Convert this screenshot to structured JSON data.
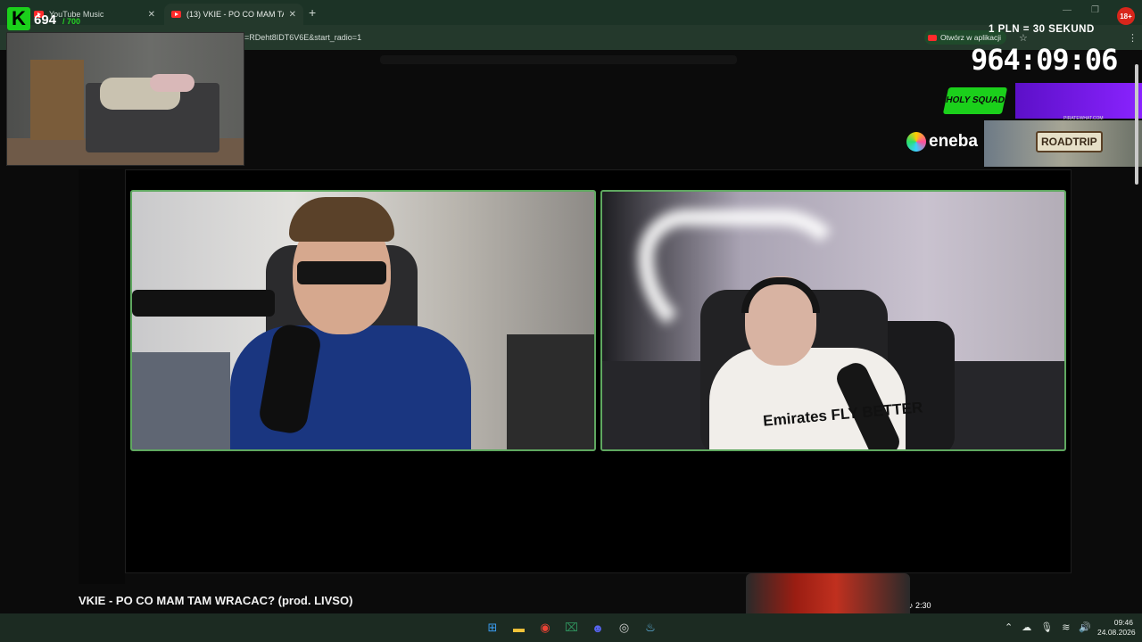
{
  "browser": {
    "tabs": [
      {
        "label": "YouTube Music",
        "active": false
      },
      {
        "label": "(13) VKIE - PO CO MAM TAM W",
        "active": true
      }
    ],
    "url": "=RDeht8IDT6V6E&start_radio=1",
    "open_in_app_label": "Otwórz w aplikacji",
    "badge_18": "18+"
  },
  "overlay": {
    "logo_letter": "K",
    "count": "694",
    "count_max": "/ 700",
    "timer_label": "1 PLN = 30 SEKUND",
    "timer": "964:09:06",
    "holy_squad": "HOLY SQUAD",
    "pirate_text": "PIRATEWHAT.COM",
    "eneba": "eneba",
    "roadtrip": "ROADTRIP"
  },
  "video": {
    "title": "VKIE - PO CO MAM TAM WRACAC? (prod. LIVSO)",
    "jersey_text": "Emirates FLY BETTER",
    "duration": "2:30"
  },
  "taskbar": {
    "apps": [
      {
        "name": "windows-start",
        "glyph": "⊞",
        "color": "#3a9cf0"
      },
      {
        "name": "file-explorer",
        "glyph": "▬",
        "color": "#f2c33a"
      },
      {
        "name": "chrome",
        "glyph": "◉",
        "color": "#ea4335"
      },
      {
        "name": "excel-like",
        "glyph": "⌧",
        "color": "#2f8f5c"
      },
      {
        "name": "discord",
        "glyph": "☻",
        "color": "#5865f2"
      },
      {
        "name": "obs",
        "glyph": "◎",
        "color": "#cfcfcf"
      },
      {
        "name": "steam",
        "glyph": "♨",
        "color": "#66c0f4"
      }
    ],
    "time": "09:46",
    "date": "24.08.2026"
  },
  "colors": {
    "accent_green": "#1bd01b",
    "cam_border": "#5fa860",
    "chrome_bg": "#1c3326"
  }
}
